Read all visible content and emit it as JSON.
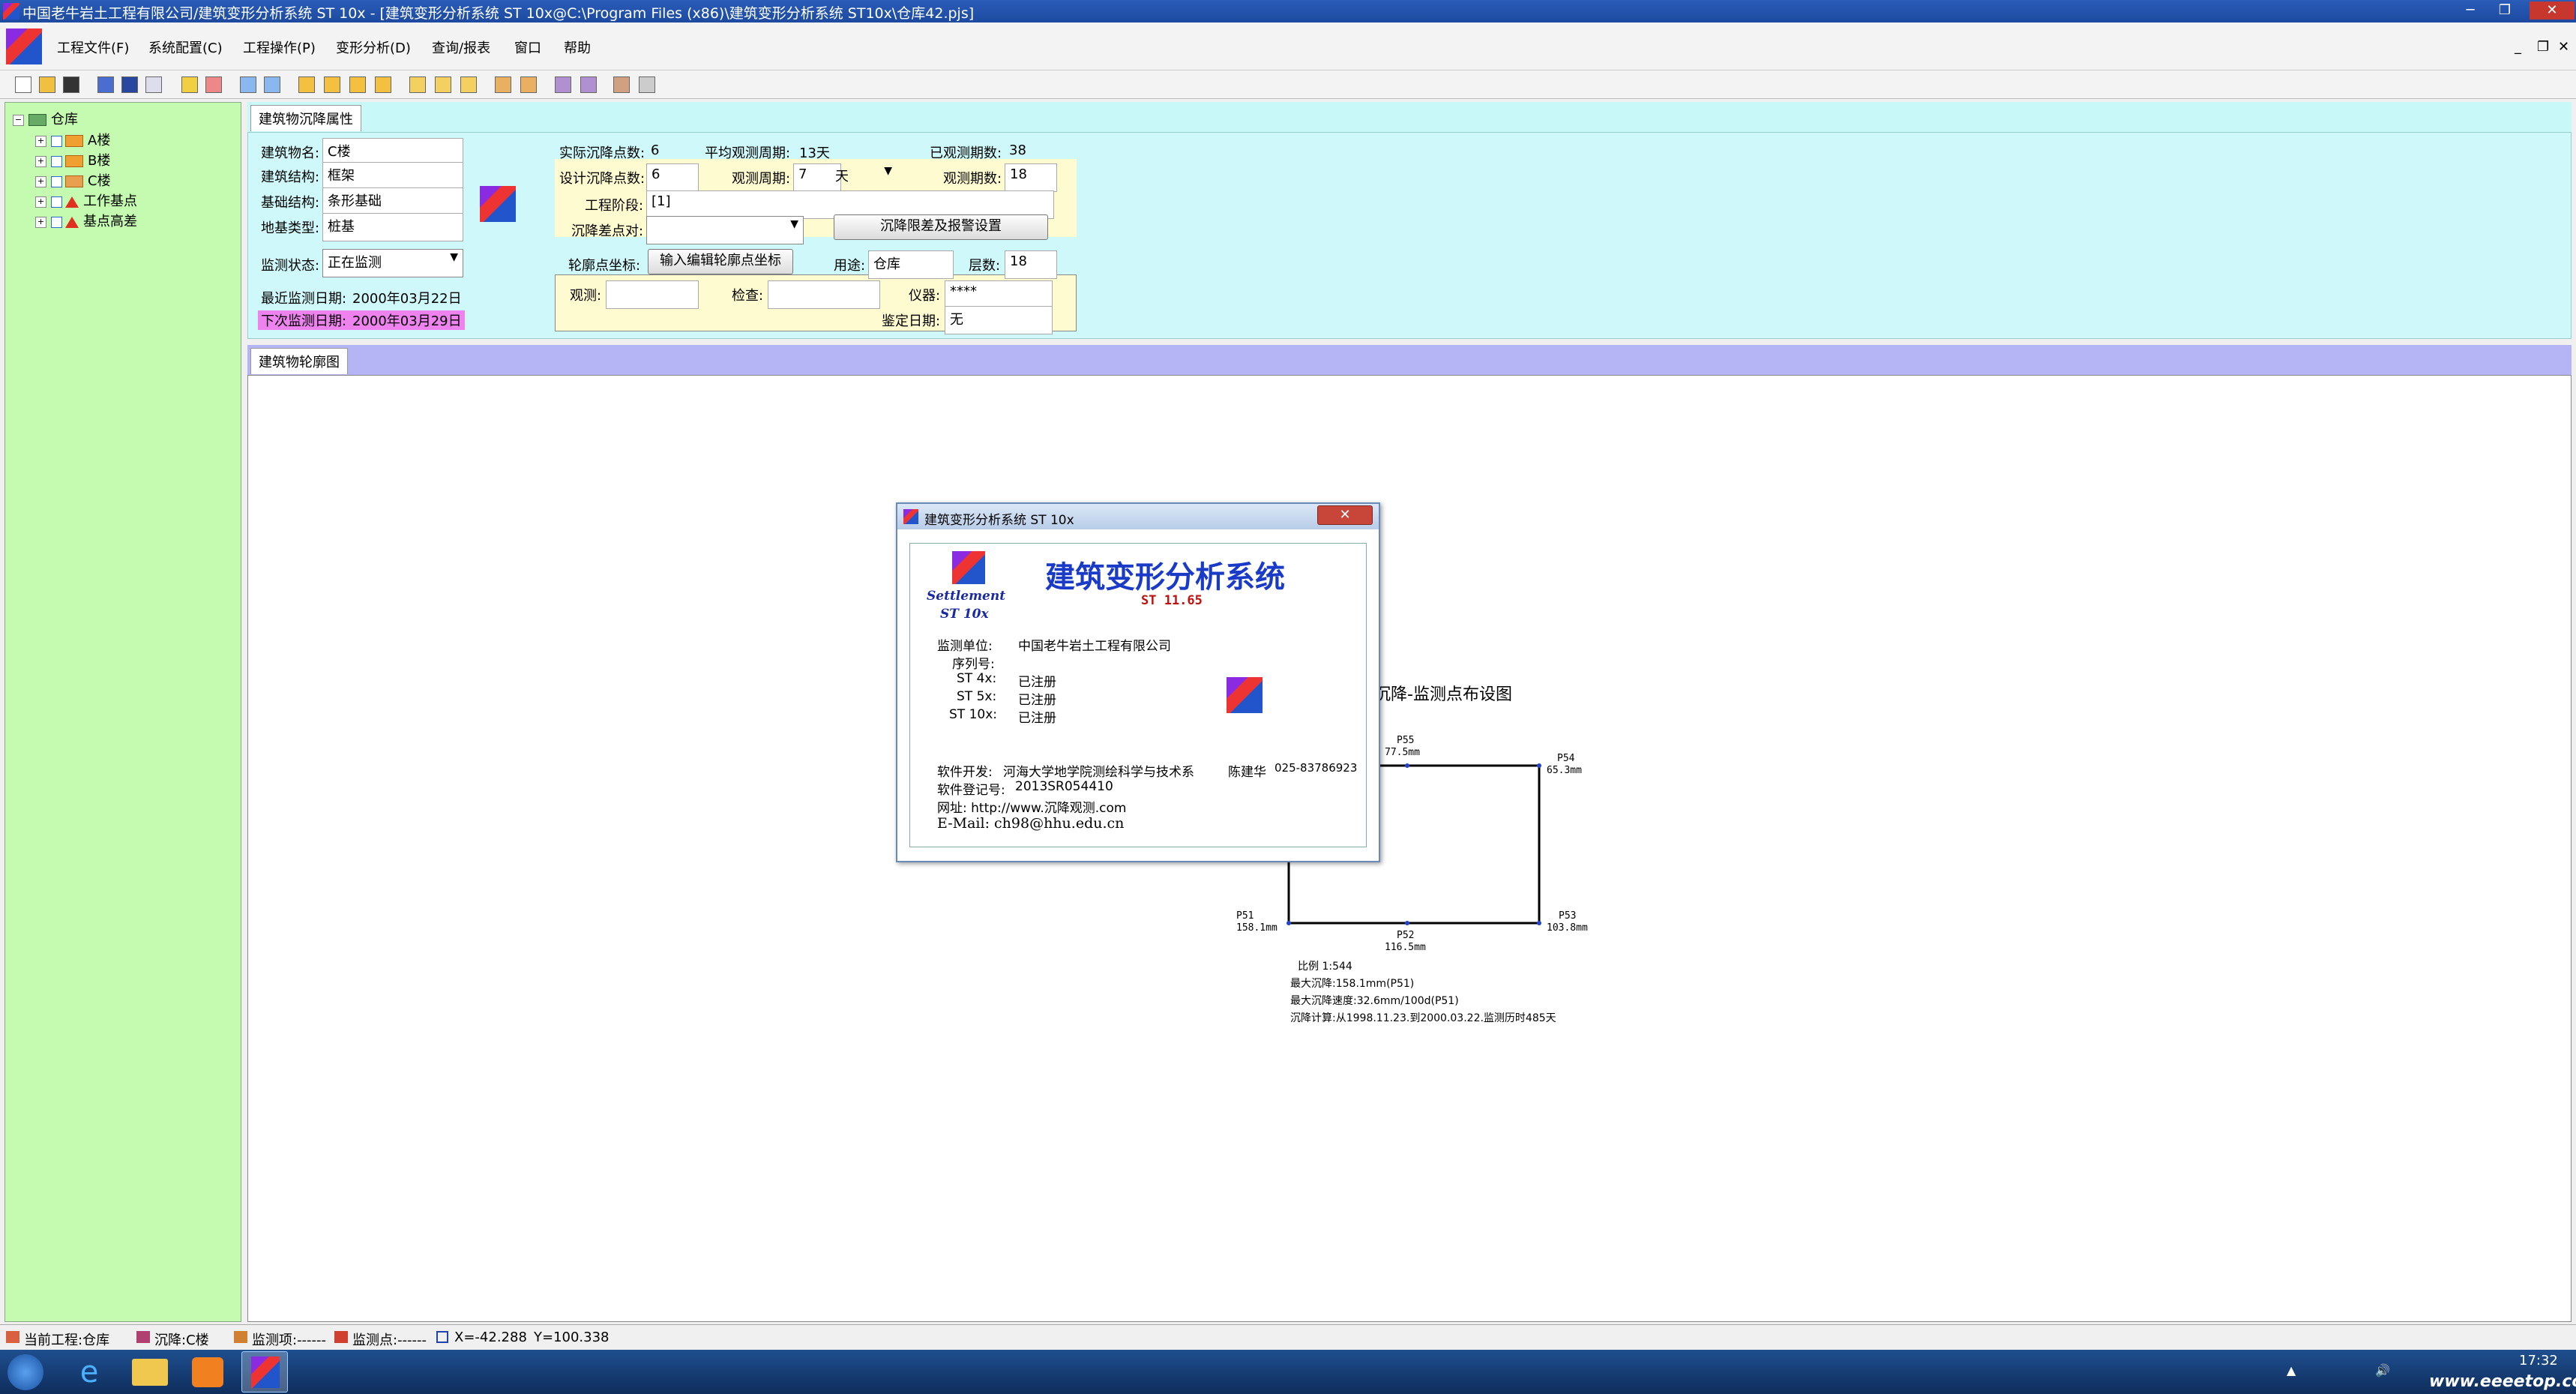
{
  "window": {
    "title": "中国老牛岩土工程有限公司/建筑变形分析系统 ST 10x - [建筑变形分析系统 ST 10x@C:\\Program Files (x86)\\建筑变形分析系统 ST10x\\仓库42.pjs]"
  },
  "menu": [
    "工程文件(F)",
    "系统配置(C)",
    "工程操作(P)",
    "变形分析(D)",
    "查询/报表",
    "窗口",
    "帮助"
  ],
  "tree": {
    "root": "仓库",
    "items": [
      "A楼",
      "B楼",
      "C楼",
      "工作基点",
      "基点高差"
    ]
  },
  "props": {
    "tab": "建筑物沉降属性",
    "building_name_label": "建筑物名:",
    "building_name": "C楼",
    "structure_label": "建筑结构:",
    "structure": "框架",
    "foundation_label": "基础结构:",
    "foundation": "条形基础",
    "ground_label": "地基类型:",
    "ground": "桩基",
    "monitor_state_label": "监测状态:",
    "monitor_state": "正在监测",
    "last_date_label": "最近监测日期:",
    "last_date": "2000年03月22日",
    "next_date_label": "下次监测日期:",
    "next_date": "2000年03月29日",
    "actual_points_label": "实际沉降点数:",
    "actual_points": "6",
    "avg_period_label": "平均观测周期:",
    "avg_period": "13天",
    "observed_label": "已观测期数:",
    "observed": "38",
    "design_points_label": "设计沉降点数:",
    "design_points": "6",
    "period_label": "观测周期:",
    "period": "7",
    "period_unit": "天",
    "obs_count_label": "观测期数:",
    "obs_count": "18",
    "stage_label": "工程阶段:",
    "stage": "[1]",
    "diff_label": "沉降差点对:",
    "diff": "",
    "limit_button": "沉降限差及报警设置",
    "outline_label": "轮廓点坐标:",
    "outline_button": "输入编辑轮廓点坐标",
    "usage_label": "用途:",
    "usage": "仓库",
    "floors_label": "层数:",
    "floors": "18",
    "observe_label": "观测:",
    "observe": "",
    "check_label": "检查:",
    "check": "",
    "instrument_label": "仪器:",
    "instrument": "****",
    "verify_label": "鉴定日期:",
    "verify": "无"
  },
  "outline": {
    "tab": "建筑物轮廓图",
    "chart_title": "沉降-监测点布设图",
    "points": [
      {
        "name": "P51",
        "value": "158.1mm"
      },
      {
        "name": "P52",
        "value": "116.5mm"
      },
      {
        "name": "P53",
        "value": "103.8mm"
      },
      {
        "name": "P54",
        "value": "65.3mm"
      },
      {
        "name": "P55",
        "value": "77.5mm"
      }
    ],
    "stats": [
      "比例 1:544",
      "最大沉降:158.1mm(P51)",
      "最大沉降速度:32.6mm/100d(P51)",
      "沉降计算:从1998.11.23.到2000.03.22.监测历时485天"
    ]
  },
  "dialog": {
    "title": "建筑变形分析系统 ST 10x",
    "heading": "建筑变形分析系统",
    "logo_line1": "Settlement",
    "logo_line2": "ST 10x",
    "version": "ST 11.65",
    "unit_label": "监测单位:",
    "unit": "中国老牛岩土工程有限公司",
    "serial_label": "序列号:",
    "licenses": [
      {
        "name": "ST 4x:",
        "status": "已注册"
      },
      {
        "name": "ST 5x:",
        "status": "已注册"
      },
      {
        "name": "ST 10x:",
        "status": "已注册"
      }
    ],
    "dev_label": "软件开发:",
    "dev": "河海大学地学院测绘科学与技术系",
    "author": "陈建华",
    "phone": "025-83786923",
    "reg_label": "软件登记号:",
    "reg": "2013SR054410",
    "web": "网址: http://www.沉降观测.com",
    "email": "E-Mail: ch98@hhu.edu.cn"
  },
  "status": {
    "project": "当前工程:仓库",
    "settle": "沉降:C楼",
    "item": "监测项:------",
    "point": "监测点:------",
    "x": "X=-42.288",
    "y": "Y=100.338"
  },
  "taskbar": {
    "time": "17:32",
    "watermark": "www.eeeetop.com"
  }
}
